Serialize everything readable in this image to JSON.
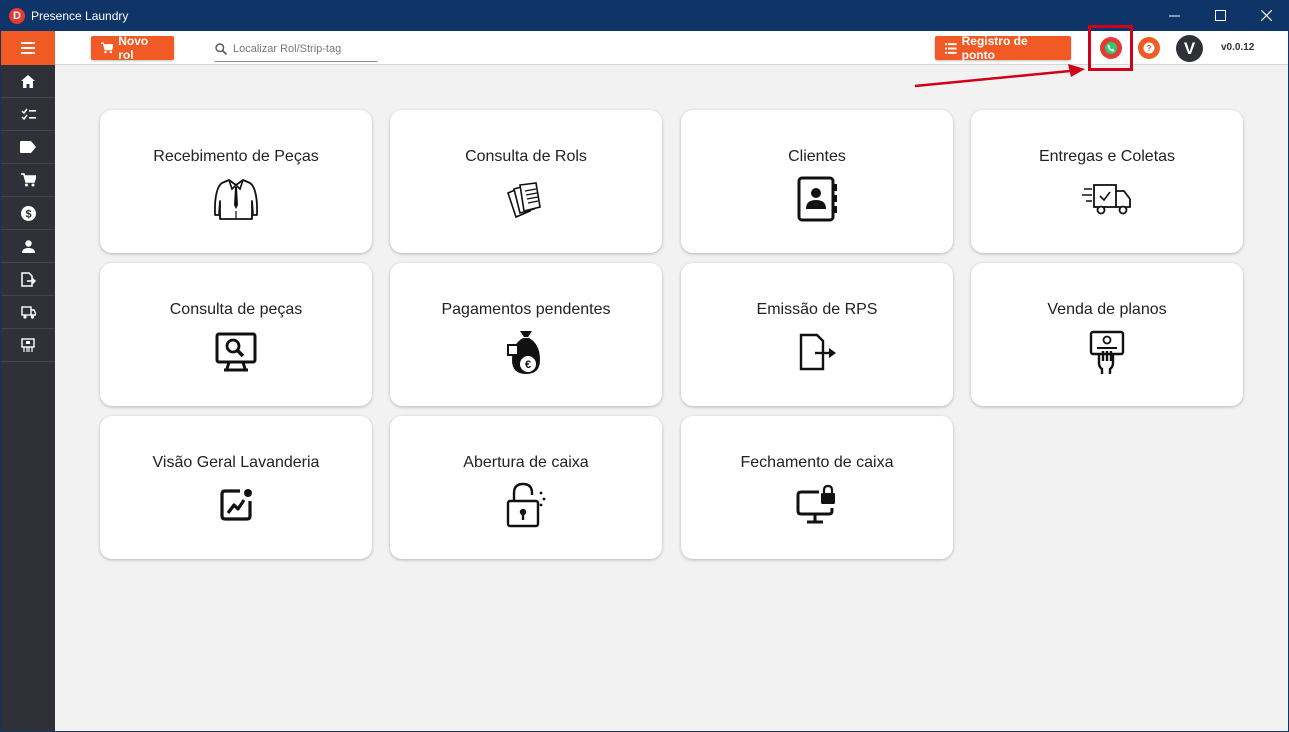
{
  "window": {
    "title": "Presence Laundry",
    "logo_letter": "D"
  },
  "sidebar": {
    "items": [
      {
        "name": "home-icon"
      },
      {
        "name": "checklist-icon"
      },
      {
        "name": "tag-icon"
      },
      {
        "name": "cart-icon"
      },
      {
        "name": "dollar-icon"
      },
      {
        "name": "person-icon"
      },
      {
        "name": "export-document-icon"
      },
      {
        "name": "delivery-truck-icon"
      },
      {
        "name": "package-icon"
      }
    ]
  },
  "topbar": {
    "novo_rol": "Novo rol",
    "search_placeholder": "Localizar Rol/Strip-tag",
    "registro_ponto": "Registro de ponto",
    "avatar_letter": "V",
    "version": "v0.0.12"
  },
  "cards": [
    {
      "title": "Recebimento de Peças",
      "icon": "shirt-icon"
    },
    {
      "title": "Consulta de Rols",
      "icon": "papers-icon"
    },
    {
      "title": "Clientes",
      "icon": "contact-book-icon"
    },
    {
      "title": "Entregas e Coletas",
      "icon": "delivery-truck-icon"
    },
    {
      "title": "Consulta de peças",
      "icon": "monitor-search-icon"
    },
    {
      "title": "Pagamentos pendentes",
      "icon": "money-bag-icon"
    },
    {
      "title": "Emissão de RPS",
      "icon": "document-export-icon"
    },
    {
      "title": "Venda de planos",
      "icon": "card-hand-icon"
    },
    {
      "title": "Visão Geral Lavanderia",
      "icon": "chart-icon"
    },
    {
      "title": "Abertura de caixa",
      "icon": "padlock-icon"
    },
    {
      "title": "Fechamento de caixa",
      "icon": "monitor-lock-icon"
    }
  ],
  "colors": {
    "accent": "#f15a24",
    "titlebar": "#0e3468",
    "sidebar": "#2f3038",
    "alert": "#e53935",
    "call_green": "#2ecc71"
  }
}
